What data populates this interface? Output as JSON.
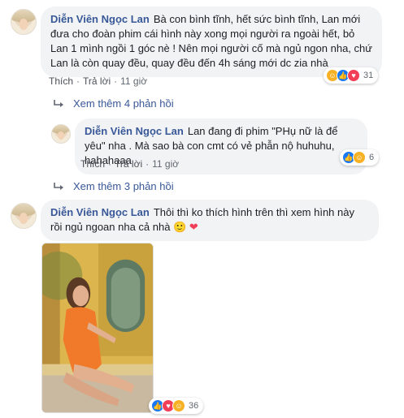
{
  "comments": [
    {
      "author": "Diễn Viên Ngọc Lan",
      "text": "Bà con bình tĩnh, hết sức bình tĩnh, Lan mới đưa cho đoàn phim cái hình này xong mọi người ra ngoài hết, bỏ Lan 1 mình ngồi 1 góc nè ! Nên mọi người cố mà ngủ ngon nha, chứ Lan là còn quay đều, quay đều đến 4h sáng mới dc zia nhà",
      "like_label": "Thích",
      "reply_label": "Trả lời",
      "time": "11 giờ",
      "reaction_count": "31",
      "more_replies": "Xem thêm 4 phản hồi"
    },
    {
      "author": "Diễn Viên Ngọc Lan",
      "text": "Lan đang đi phim \"PHụ nữ là để yêu\" nha . Mà sao bà con cmt có vẻ phẫn nộ huhuhu, hahahaaa",
      "like_label": "Thích",
      "reply_label": "Trả lời",
      "time": "11 giờ",
      "reaction_count": "6",
      "more_replies": "Xem thêm 3 phản hồi"
    },
    {
      "author": "Diễn Viên Ngọc Lan",
      "text": "Thôi thì ko thích hình trên thì xem hình này rồi ngủ ngoan nha cả nhà",
      "emoji": "🙂 ❤",
      "reaction_count": "36"
    }
  ],
  "colors": {
    "author": "#385898",
    "bubble": "#f2f3f5",
    "like": "#1877f2",
    "haha": "#f7b125",
    "love": "#f33e58"
  }
}
